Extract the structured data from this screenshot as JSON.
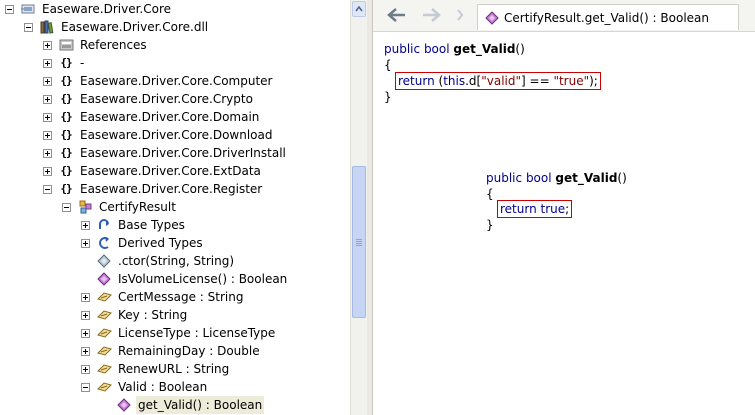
{
  "tree": {
    "root": "Easeware.Driver.Core",
    "dll": "Easeware.Driver.Core.dll",
    "references": "References",
    "ns_dash": "-",
    "ns_computer": "Easeware.Driver.Core.Computer",
    "ns_crypto": "Easeware.Driver.Core.Crypto",
    "ns_domain": "Easeware.Driver.Core.Domain",
    "ns_download": "Easeware.Driver.Core.Download",
    "ns_driverinstall": "Easeware.Driver.Core.DriverInstall",
    "ns_extdata": "Easeware.Driver.Core.ExtData",
    "ns_register": "Easeware.Driver.Core.Register",
    "class_certify": "CertifyResult",
    "base_types": "Base Types",
    "derived_types": "Derived Types",
    "ctor": ".ctor(String, String)",
    "is_volume_license": "IsVolumeLicense() : Boolean",
    "cert_message": "CertMessage : String",
    "key": "Key : String",
    "license_type": "LicenseType : LicenseType",
    "remaining_day": "RemainingDay : Double",
    "renew_url": "RenewURL : String",
    "valid": "Valid : Boolean",
    "get_valid": "get_Valid() : Boolean",
    "brace_glyph": "{}"
  },
  "tab": {
    "title": "CertifyResult.get_Valid() : Boolean"
  },
  "code1": {
    "kw_public": "public",
    "kw_bool": "bool",
    "method": "get_Valid",
    "parens": "()",
    "open": "{",
    "close": "}",
    "stmt_return": "return",
    "stmt_mid1": " (",
    "stmt_this": "this",
    "stmt_mid2": ".d[",
    "stmt_str_valid": "\"valid\"",
    "stmt_mid3": "] == ",
    "stmt_str_true": "\"true\"",
    "stmt_end": ");"
  },
  "code2": {
    "kw_public": "public",
    "kw_bool": "bool",
    "method": "get_Valid",
    "parens": "()",
    "open": "{",
    "close": "}",
    "stmt_return": "return",
    "stmt_true": "true",
    "stmt_end": ";"
  },
  "colors": {
    "keyword": "#00008b",
    "string": "#800000",
    "highlight_box": "#cc0000",
    "selection": "#ececd9"
  }
}
